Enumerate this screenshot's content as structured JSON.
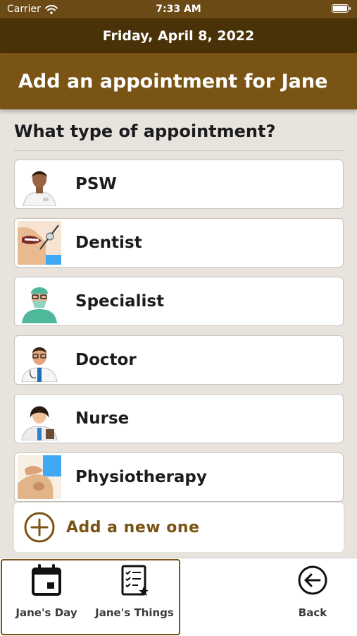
{
  "status_bar": {
    "carrier": "Carrier",
    "time": "7:33 AM"
  },
  "date": "Friday, April 8, 2022",
  "header": {
    "title": "Add an appointment for Jane"
  },
  "question": "What type of appointment?",
  "options": [
    {
      "label": "PSW",
      "icon": "psw-avatar"
    },
    {
      "label": "Dentist",
      "icon": "dentist-avatar"
    },
    {
      "label": "Specialist",
      "icon": "specialist-avatar"
    },
    {
      "label": "Doctor",
      "icon": "doctor-avatar"
    },
    {
      "label": "Nurse",
      "icon": "nurse-avatar"
    },
    {
      "label": "Physiotherapy",
      "icon": "physiotherapy-avatar"
    }
  ],
  "add_new": {
    "label": "Add a new one",
    "icon": "plus-circle-icon"
  },
  "tabs": [
    {
      "label": "Jane's Day",
      "icon": "calendar-icon"
    },
    {
      "label": "Jane's Things",
      "icon": "checklist-icon"
    },
    {
      "label": "Back",
      "icon": "back-arrow-icon"
    }
  ],
  "colors": {
    "brand_dark": "#4a3208",
    "brand": "#7a5414",
    "background": "#e8e3dd"
  }
}
